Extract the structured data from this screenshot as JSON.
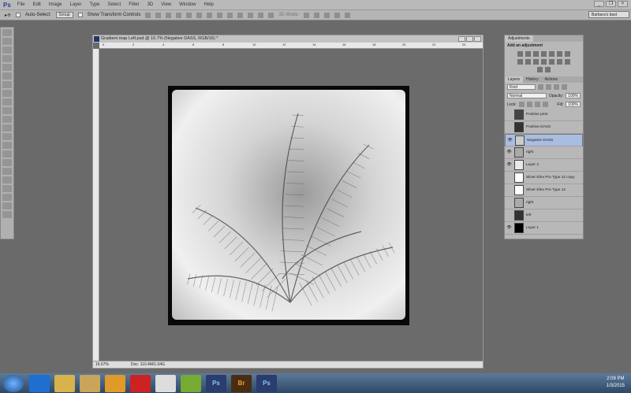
{
  "menu": {
    "logo": "Ps",
    "items": [
      "File",
      "Edit",
      "Image",
      "Layer",
      "Type",
      "Select",
      "Filter",
      "3D",
      "View",
      "Window",
      "Help"
    ]
  },
  "options": {
    "auto_select": "Auto-Select:",
    "auto_select_value": "Group",
    "show_transform": "Show Transform Controls",
    "mode_3d": "3D Mode:",
    "workspace": "Barbara's bast"
  },
  "document": {
    "title": "Gradient map Left.psd @ 16.7% (Negative DASS, RGB/16) *",
    "zoom": "16.67%",
    "doc_size": "Doc: 110.4M/1.04G",
    "ruler_marks": [
      "0",
      "2",
      "4",
      "6",
      "8",
      "10",
      "12",
      "14",
      "16",
      "18",
      "20",
      "22",
      "24"
    ]
  },
  "adjustments": {
    "tab": "Adjustments",
    "heading": "Add an adjustment"
  },
  "layers_panel": {
    "tabs": [
      "Layers",
      "History",
      "Actions"
    ],
    "filter": "Kind",
    "blend_mode": "Normal",
    "opacity_label": "Opacity:",
    "opacity": "100%",
    "lock_label": "Lock:",
    "fill_label": "Fill:",
    "fill": "100%",
    "layers": [
      {
        "name": "Positive print",
        "visible": false,
        "selected": false,
        "thumb": "#444"
      },
      {
        "name": "Positive DASS",
        "visible": false,
        "selected": false,
        "thumb": "#333"
      },
      {
        "name": "Negative DASS",
        "visible": true,
        "selected": true,
        "thumb": "#ccc"
      },
      {
        "name": "right",
        "visible": true,
        "selected": false,
        "thumb": "#aaa"
      },
      {
        "name": "Layer 2",
        "visible": true,
        "selected": false,
        "thumb": "#e8e8e8"
      },
      {
        "name": "Silver Efex Pro Type 12 copy",
        "visible": false,
        "selected": false,
        "thumb": "#fff"
      },
      {
        "name": "Silver Efex Pro Type 12",
        "visible": false,
        "selected": false,
        "thumb": "#fff"
      },
      {
        "name": "right",
        "visible": false,
        "selected": false,
        "thumb": "#aaa"
      },
      {
        "name": "left",
        "visible": false,
        "selected": false,
        "thumb": "#333"
      },
      {
        "name": "Layer 1",
        "visible": true,
        "selected": false,
        "thumb": "#000"
      }
    ]
  },
  "taskbar": {
    "apps": [
      "IE",
      "Explorer",
      "Notes",
      "Outlook",
      "App",
      "Paint",
      "Office",
      "Ps",
      "Br",
      "Ps"
    ],
    "time": "2:09 PM",
    "date": "1/3/2015"
  }
}
